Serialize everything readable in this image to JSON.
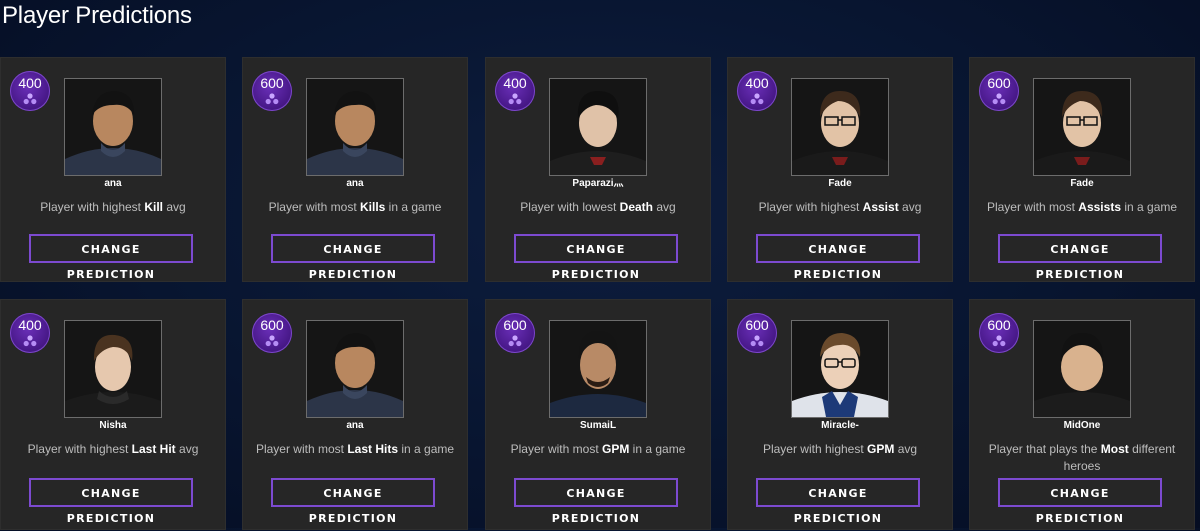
{
  "page": {
    "title": "Player Predictions"
  },
  "colors": {
    "badge": "#4a1a8c",
    "button_border": "#7c4ad0",
    "card_bg": "#262626"
  },
  "cards": [
    {
      "points": "400",
      "player": "ana",
      "pre": "Player with highest ",
      "bold": "Kill",
      "post": " avg",
      "button": "CHANGE PREDICTION",
      "badge_icon": "shards-icon"
    },
    {
      "points": "600",
      "player": "ana",
      "pre": "Player with most ",
      "bold": "Kills",
      "post": " in a game",
      "button": "CHANGE PREDICTION",
      "badge_icon": "shards-icon"
    },
    {
      "points": "400",
      "player": "Paparazi灬",
      "pre": "Player with lowest ",
      "bold": "Death",
      "post": " avg",
      "button": "CHANGE PREDICTION",
      "badge_icon": "shards-icon"
    },
    {
      "points": "400",
      "player": "Fade",
      "pre": "Player with highest ",
      "bold": "Assist",
      "post": " avg",
      "button": "CHANGE PREDICTION",
      "badge_icon": "shards-icon"
    },
    {
      "points": "600",
      "player": "Fade",
      "pre": "Player with most ",
      "bold": "Assists",
      "post": " in a game",
      "button": "CHANGE PREDICTION",
      "badge_icon": "shards-icon"
    },
    {
      "points": "400",
      "player": "Nisha",
      "pre": "Player with highest ",
      "bold": "Last Hit",
      "post": " avg",
      "button": "CHANGE PREDICTION",
      "badge_icon": "shards-icon"
    },
    {
      "points": "600",
      "player": "ana",
      "pre": "Player with most ",
      "bold": "Last Hits",
      "post": " in a game",
      "button": "CHANGE PREDICTION",
      "badge_icon": "shards-icon"
    },
    {
      "points": "600",
      "player": "SumaiL",
      "pre": "Player with most ",
      "bold": "GPM",
      "post": " in a game",
      "button": "CHANGE PREDICTION",
      "badge_icon": "shards-icon"
    },
    {
      "points": "600",
      "player": "Miracle-",
      "pre": "Player with highest ",
      "bold": "GPM",
      "post": " avg",
      "button": "CHANGE PREDICTION",
      "badge_icon": "shards-icon"
    },
    {
      "points": "600",
      "player": "MidOne",
      "pre": "Player that plays the ",
      "bold": "Most",
      "post": " different heroes",
      "button": "CHANGE PREDICTION",
      "badge_icon": "shards-icon"
    }
  ]
}
